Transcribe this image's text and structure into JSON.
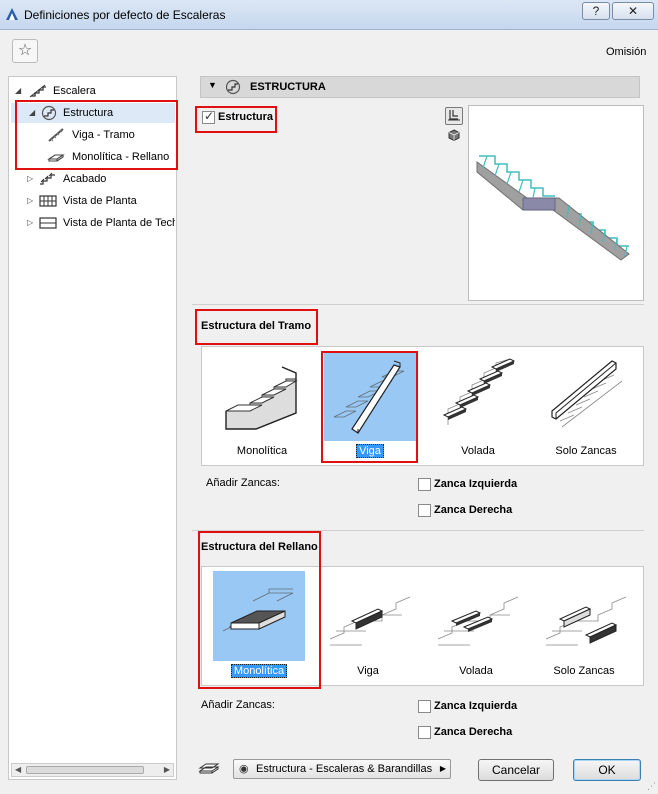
{
  "window": {
    "title": "Definiciones por defecto de Escaleras",
    "help_label": "?",
    "close_label": "✕"
  },
  "toolbar": {
    "omision_label": "Omisión"
  },
  "tree": {
    "items": [
      {
        "label": "Escalera",
        "icon": "stair-icon"
      },
      {
        "label": "Estructura",
        "icon": "structure-icon"
      },
      {
        "label": "Viga - Tramo",
        "icon": "beam-flight-icon"
      },
      {
        "label": "Monolítica - Rellano",
        "icon": "monolithic-landing-icon"
      },
      {
        "label": "Acabado",
        "icon": "finish-icon"
      },
      {
        "label": "Vista de Planta",
        "icon": "floor-plan-icon"
      },
      {
        "label": "Vista de Planta de Techo",
        "icon": "ceiling-plan-icon"
      }
    ]
  },
  "section": {
    "title": "ESTRUCTURA",
    "structure_checkbox_label": "Estructura",
    "structure_checked": true
  },
  "flight": {
    "title": "Estructura del Tramo",
    "options": [
      "Monolítica",
      "Viga",
      "Volada",
      "Solo Zancas"
    ],
    "selected": "Viga",
    "add_stringers_label": "Añadir Zancas:",
    "left_stringer_label": "Zanca Izquierda",
    "right_stringer_label": "Zanca Derecha"
  },
  "landing": {
    "title": "Estructura del Rellano",
    "options": [
      "Monolítica",
      "Viga",
      "Volada",
      "Solo Zancas"
    ],
    "selected": "Monolítica",
    "add_stringers_label": "Añadir Zancas:",
    "left_stringer_label": "Zanca Izquierda",
    "right_stringer_label": "Zanca Derecha"
  },
  "footer": {
    "panel_selector": "Estructura - Escaleras & Barandillas",
    "cancel_label": "Cancelar",
    "ok_label": "OK"
  },
  "colors": {
    "selection": "#99c8f5",
    "highlight": "#e01010",
    "stair_fill": "#a0a0a0",
    "stair_edge": "#3fbfbf"
  }
}
